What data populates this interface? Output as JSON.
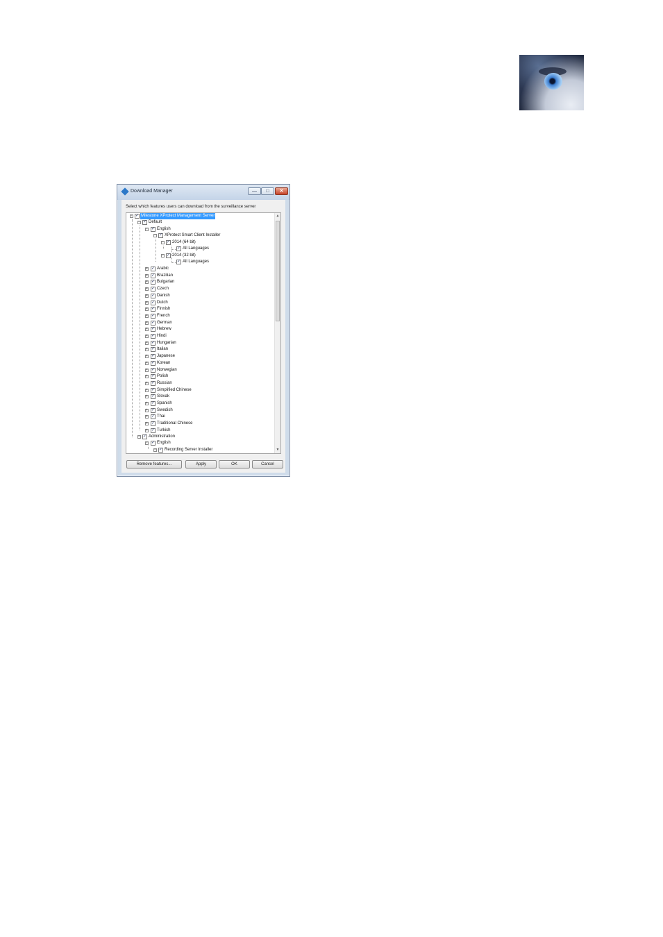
{
  "logo": {
    "icon": "wolf-eye-logo"
  },
  "window": {
    "title": "Download Manager",
    "prompt": "Select which features users can download from the surveillance server",
    "controls": {
      "minimize": "—",
      "maximize": "□",
      "close": "✕"
    }
  },
  "tree": {
    "root": "Milestone XProtect Management Server",
    "default": "Default",
    "english": "English",
    "installer": "XProtect Smart Client Installer",
    "v64": "2014 (64 bit)",
    "v64_lang": "All Languages",
    "v32": "2014 (32 bit)",
    "v32_lang": "All Languages",
    "languages": [
      "Arabic",
      "Brazilian",
      "Bulgarian",
      "Czech",
      "Danish",
      "Dutch",
      "Finnish",
      "French",
      "German",
      "Hebrew",
      "Hindi",
      "Hungarian",
      "Italian",
      "Japanese",
      "Korean",
      "Norwegian",
      "Polish",
      "Russian",
      "Simplified Chinese",
      "Slovak",
      "Spanish",
      "Swedish",
      "Thai",
      "Traditional Chinese",
      "Turkish"
    ],
    "administration": "Administration",
    "admin_english": "English",
    "recording": "Recording Server Installer"
  },
  "buttons": {
    "remove": "Remove features...",
    "apply": "Apply",
    "ok": "OK",
    "cancel": "Cancel"
  }
}
